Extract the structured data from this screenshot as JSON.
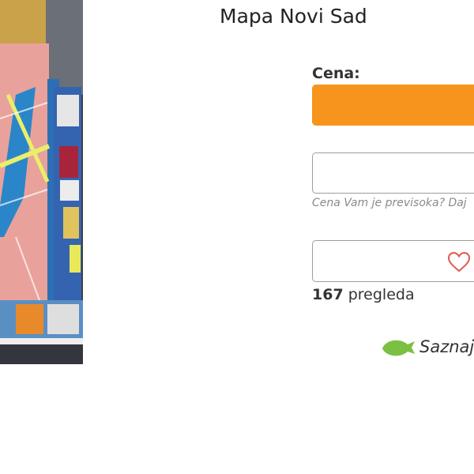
{
  "listing": {
    "title": "Mapa Novi Sad",
    "price_label": "Cena:",
    "offer_placeholder": "",
    "offer_hint": "Cena Vam je previsoka? Daj",
    "views_count": "167",
    "views_label": "pregleda",
    "learn_more": "Saznaj"
  },
  "colors": {
    "price_bar": "#f7941d",
    "heart": "#e05a4e",
    "leaf": "#7cc043"
  },
  "icons": {
    "favorite": "heart-icon",
    "learn_more": "leaf-icon"
  }
}
